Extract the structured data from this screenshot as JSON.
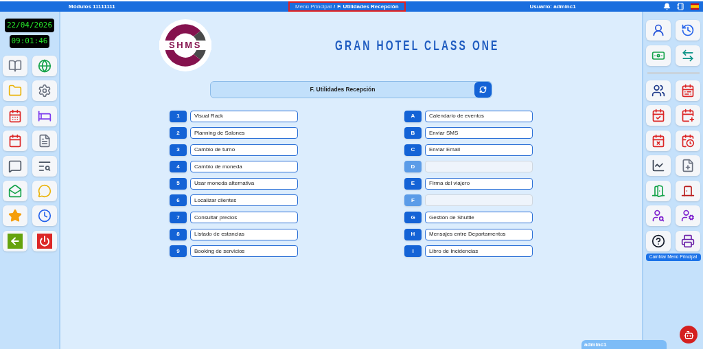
{
  "top_bar": {
    "modules": "Módulos 11111111",
    "breadcrumb": {
      "highlighted": true,
      "separator": "/",
      "items": [
        {
          "label": "Menú Principal",
          "current": false
        },
        {
          "label": "F. Utilidades Recepción",
          "current": true
        }
      ]
    },
    "user": "Usuario: adminc1"
  },
  "clock": {
    "date": "22/04/2026",
    "time": "09:01:46"
  },
  "logo": {
    "text": "SHMS"
  },
  "title": "GRAN HOTEL CLASS ONE",
  "menu": {
    "title": "F. Utilidades Recepción",
    "left": [
      {
        "key": "1",
        "label": "Visual Rack",
        "disabled": false
      },
      {
        "key": "2",
        "label": "Planning de Salones",
        "disabled": false
      },
      {
        "key": "3",
        "label": "Cambio de turno",
        "disabled": false
      },
      {
        "key": "4",
        "label": "Cambio de moneda",
        "disabled": false
      },
      {
        "key": "5",
        "label": "Usar moneda alternativa",
        "disabled": false
      },
      {
        "key": "6",
        "label": "Localizar clientes",
        "disabled": false
      },
      {
        "key": "7",
        "label": "Consultar precios",
        "disabled": false
      },
      {
        "key": "8",
        "label": "Listado de estancias",
        "disabled": false
      },
      {
        "key": "9",
        "label": "Booking de servicios",
        "disabled": false
      }
    ],
    "right": [
      {
        "key": "A",
        "label": "Calendario de eventos",
        "disabled": false
      },
      {
        "key": "B",
        "label": "Enviar SMS",
        "disabled": false
      },
      {
        "key": "C",
        "label": "Enviar Email",
        "disabled": false
      },
      {
        "key": "D",
        "disabled": true
      },
      {
        "key": "E",
        "label": "Firma del viajero",
        "disabled": false
      },
      {
        "key": "F",
        "disabled": true
      },
      {
        "key": "G",
        "label": "Gestión de Shuttle",
        "disabled": false
      },
      {
        "key": "H",
        "label": "Mensajes entre Departamentos",
        "disabled": false
      },
      {
        "key": "I",
        "label": "Libro de Incidencias",
        "disabled": false
      }
    ]
  },
  "right_sidebar": {
    "button": "Cambiar Menú Principal"
  },
  "bottom_tab": "adminc1"
}
